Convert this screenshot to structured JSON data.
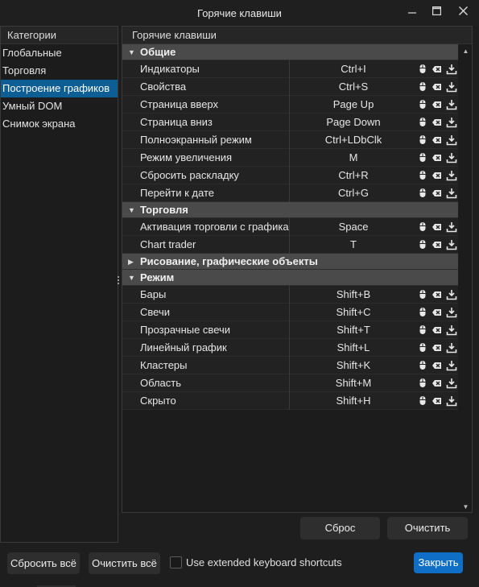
{
  "window": {
    "title": "Горячие клавиши"
  },
  "sidebar": {
    "header": "Категории",
    "items": [
      {
        "label": "Глобальные",
        "active": false
      },
      {
        "label": "Торговля",
        "active": false
      },
      {
        "label": "Построение графиков",
        "active": true
      },
      {
        "label": "Умный DOM",
        "active": false
      },
      {
        "label": "Снимок экрана",
        "active": false
      }
    ]
  },
  "main": {
    "header": "Горячие клавиши",
    "groups": [
      {
        "title": "Общие",
        "expanded": true,
        "rows": [
          {
            "name": "Индикаторы",
            "key": "Ctrl+I"
          },
          {
            "name": "Свойства",
            "key": "Ctrl+S"
          },
          {
            "name": "Страница вверх",
            "key": "Page Up"
          },
          {
            "name": "Страница вниз",
            "key": "Page Down"
          },
          {
            "name": "Полноэкранный режим",
            "key": "Ctrl+LDbClk"
          },
          {
            "name": "Режим увеличения",
            "key": "M"
          },
          {
            "name": "Сбросить раскладку",
            "key": "Ctrl+R"
          },
          {
            "name": "Перейти к дате",
            "key": "Ctrl+G"
          }
        ]
      },
      {
        "title": "Торговля",
        "expanded": true,
        "rows": [
          {
            "name": "Активация торговли с графика",
            "key": "Space"
          },
          {
            "name": "Chart trader",
            "key": "T"
          }
        ]
      },
      {
        "title": "Рисование, графические объекты",
        "expanded": false,
        "rows": []
      },
      {
        "title": "Режим",
        "expanded": true,
        "rows": [
          {
            "name": "Бары",
            "key": "Shift+B"
          },
          {
            "name": "Свечи",
            "key": "Shift+C"
          },
          {
            "name": "Прозрачные свечи",
            "key": "Shift+T"
          },
          {
            "name": "Линейный график",
            "key": "Shift+L"
          },
          {
            "name": "Кластеры",
            "key": "Shift+K"
          },
          {
            "name": "Область",
            "key": "Shift+M"
          },
          {
            "name": "Скрыто",
            "key": "Shift+H"
          }
        ]
      }
    ],
    "reset_label": "Сброс",
    "clear_label": "Очистить"
  },
  "footer": {
    "reset_all_label": "Сбросить всё",
    "clear_all_label": "Очистить всё",
    "extended_label": "Use extended keyboard shortcuts",
    "extended_checked": false,
    "close_label": "Закрыть"
  },
  "colors": {
    "accent": "#0f6fc6",
    "selected": "#0e5e96",
    "group_bg": "#4a4a4a"
  },
  "icons": {
    "row_icons": [
      "mouse-icon",
      "clear-icon",
      "reset-icon"
    ]
  }
}
